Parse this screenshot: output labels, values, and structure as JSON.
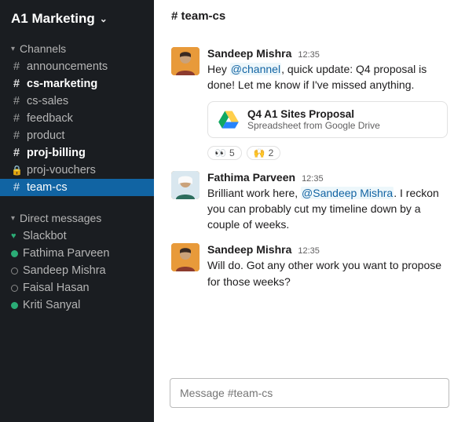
{
  "workspace": {
    "name": "A1 Marketing"
  },
  "sidebar": {
    "channels_header": "Channels",
    "dms_header": "Direct messages",
    "channels": [
      {
        "name": "announcements",
        "bold": false,
        "private": false,
        "active": false
      },
      {
        "name": "cs-marketing",
        "bold": true,
        "private": false,
        "active": false
      },
      {
        "name": "cs-sales",
        "bold": false,
        "private": false,
        "active": false
      },
      {
        "name": "feedback",
        "bold": false,
        "private": false,
        "active": false
      },
      {
        "name": "product",
        "bold": false,
        "private": false,
        "active": false
      },
      {
        "name": "proj-billing",
        "bold": true,
        "private": false,
        "active": false
      },
      {
        "name": "proj-vouchers",
        "bold": false,
        "private": true,
        "active": false
      },
      {
        "name": "team-cs",
        "bold": false,
        "private": false,
        "active": true
      }
    ],
    "dms": [
      {
        "name": "Slackbot",
        "status": "heart"
      },
      {
        "name": "Fathima Parveen",
        "status": "online"
      },
      {
        "name": "Sandeep Mishra",
        "status": "offline"
      },
      {
        "name": "Faisal Hasan",
        "status": "offline"
      },
      {
        "name": "Kriti Sanyal",
        "status": "online"
      }
    ]
  },
  "header": {
    "channel": "# team-cs"
  },
  "messages": [
    {
      "author": "Sandeep Mishra",
      "time": "12:35",
      "avatar": "sandeep",
      "segments": [
        {
          "t": "Hey "
        },
        {
          "t": "@channel",
          "mention": true
        },
        {
          "t": ", quick update: Q4 proposal is done! Let me know if I've missed anything."
        }
      ],
      "attachment": {
        "title": "Q4 A1 Sites Proposal",
        "subtitle": "Spreadsheet from Google Drive",
        "icon": "google-drive"
      },
      "reactions": [
        {
          "emoji": "👀",
          "count": "5"
        },
        {
          "emoji": "🙌",
          "count": "2"
        }
      ]
    },
    {
      "author": "Fathima Parveen",
      "time": "12:35",
      "avatar": "fathima",
      "segments": [
        {
          "t": "Brilliant work here, "
        },
        {
          "t": "@Sandeep Mishra",
          "mention": true
        },
        {
          "t": ". I reckon you can probably cut my timeline down by a couple of weeks."
        }
      ]
    },
    {
      "author": "Sandeep Mishra",
      "time": "12:35",
      "avatar": "sandeep",
      "segments": [
        {
          "t": "Will do. Got any other work you want to propose for those weeks?"
        }
      ]
    }
  ],
  "composer": {
    "placeholder": "Message #team-cs"
  }
}
